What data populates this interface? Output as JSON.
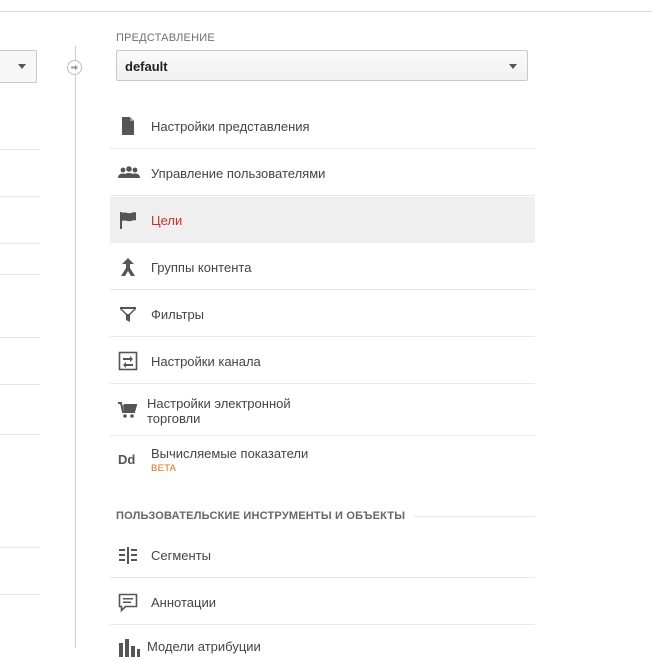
{
  "view": {
    "section_label": "ПРЕДСТАВЛЕНИЕ",
    "selected": "default"
  },
  "menu": {
    "items": [
      {
        "label": "Настройки представления",
        "icon": "document-icon"
      },
      {
        "label": "Управление пользователями",
        "icon": "users-icon"
      },
      {
        "label": "Цели",
        "icon": "flag-icon",
        "active": true
      },
      {
        "label": "Группы контента",
        "icon": "content-group-icon"
      },
      {
        "label": "Фильтры",
        "icon": "filter-icon"
      },
      {
        "label": "Настройки канала",
        "icon": "channel-settings-icon"
      },
      {
        "label": "Настройки электронной торговли",
        "icon": "cart-icon"
      },
      {
        "label": "Вычисляемые показатели",
        "icon": "dd-icon",
        "badge": "BETA"
      }
    ]
  },
  "tools": {
    "section_label": "ПОЛЬЗОВАТЕЛЬСКИЕ ИНСТРУМЕНТЫ И ОБЪЕКТЫ",
    "items": [
      {
        "label": "Сегменты",
        "icon": "segments-icon"
      },
      {
        "label": "Аннотации",
        "icon": "annotation-icon"
      },
      {
        "label": "Модели атрибуции",
        "icon": "attribution-icon"
      }
    ]
  },
  "icon_glyphs": {
    "dd": "Dd"
  },
  "colors": {
    "active_text": "#c4312d",
    "beta": "#e06b1e",
    "icon": "#555555"
  }
}
